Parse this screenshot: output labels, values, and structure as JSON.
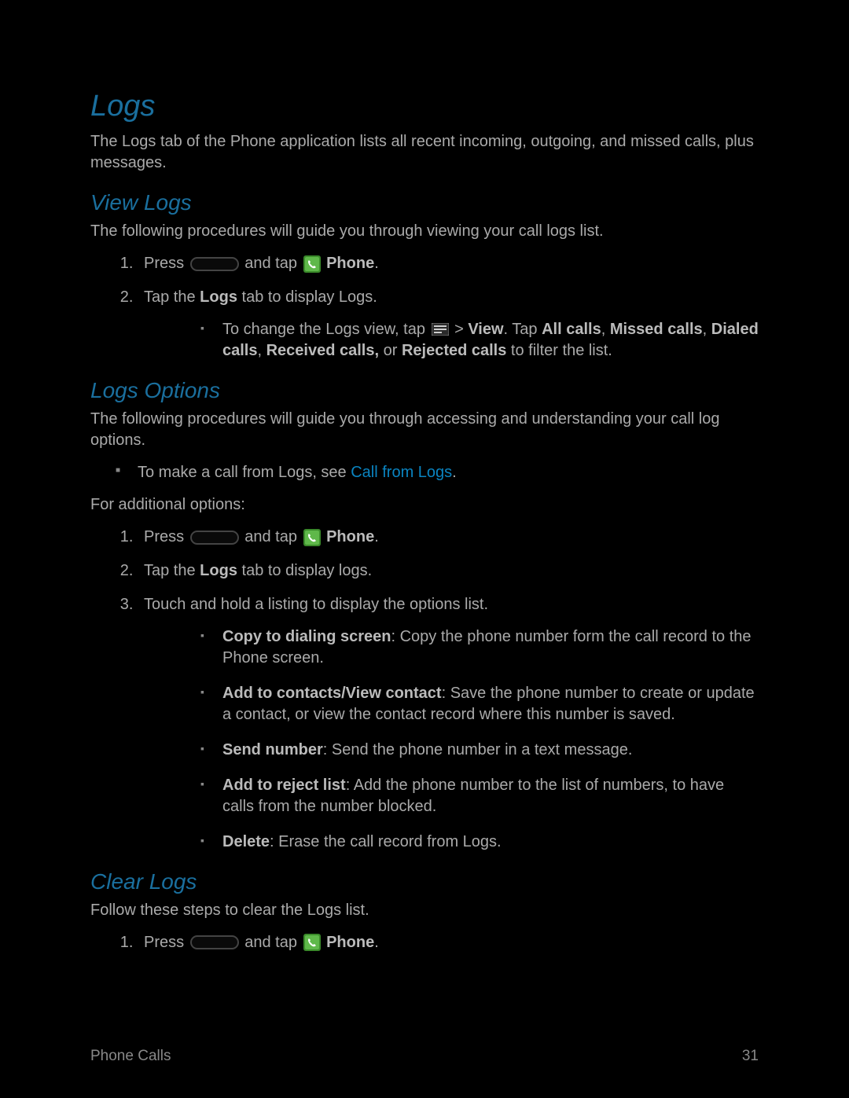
{
  "title": "Logs",
  "intro": "The Logs tab of the Phone application lists all recent incoming, outgoing, and missed calls, plus messages.",
  "view": {
    "heading": "View Logs",
    "intro": "The following procedures will guide you through viewing your call logs list.",
    "step1_pre": "Press ",
    "step1_mid": " and tap ",
    "step1_phone": "Phone",
    "step1_post": ".",
    "step2_pre": "Tap the ",
    "step2_logs": "Logs",
    "step2_post": " tab to display Logs.",
    "sub_pre": "To change the Logs view, tap ",
    "sub_gt": " > ",
    "sub_view": "View",
    "sub_mid1": ". Tap ",
    "sub_all": "All calls",
    "sub_c1": ", ",
    "sub_missed": "Missed calls",
    "sub_c2": ", ",
    "sub_dialed": "Dialed calls",
    "sub_c3": ", ",
    "sub_received": "Received calls,",
    "sub_or": " or ",
    "sub_rejected": "Rejected calls",
    "sub_post": " to filter the list."
  },
  "options": {
    "heading": "Logs Options",
    "intro": "The following procedures will guide you through accessing and understanding your call log options.",
    "bullet_pre": "To make a call from Logs, see ",
    "bullet_link": "Call from Logs",
    "bullet_post": ".",
    "additional": "For additional options:",
    "s1_pre": "Press ",
    "s1_mid": " and tap ",
    "s1_phone": "Phone",
    "s1_post": ".",
    "s2_pre": "Tap the ",
    "s2_logs": "Logs",
    "s2_post": " tab to display logs.",
    "s3": "Touch and hold a listing to display the options list.",
    "opt1_b": "Copy to dialing screen",
    "opt1_t": ": Copy the phone number form the call record to the Phone screen.",
    "opt2_b": "Add to contacts/View contact",
    "opt2_t": ": Save the phone number to create or update a contact, or view the contact record where this number is saved.",
    "opt3_b": "Send number",
    "opt3_t": ": Send the phone number in a text message.",
    "opt4_b": "Add to reject list",
    "opt4_t": ": Add the phone number to the list of numbers, to have calls from the number blocked.",
    "opt5_b": "Delete",
    "opt5_t": ": Erase the call record from Logs."
  },
  "clear": {
    "heading": "Clear Logs",
    "intro": "Follow these steps to clear the Logs list.",
    "s1_pre": "Press ",
    "s1_mid": " and tap ",
    "s1_phone": "Phone",
    "s1_post": "."
  },
  "footer": {
    "left": "Phone Calls",
    "right": "31"
  }
}
